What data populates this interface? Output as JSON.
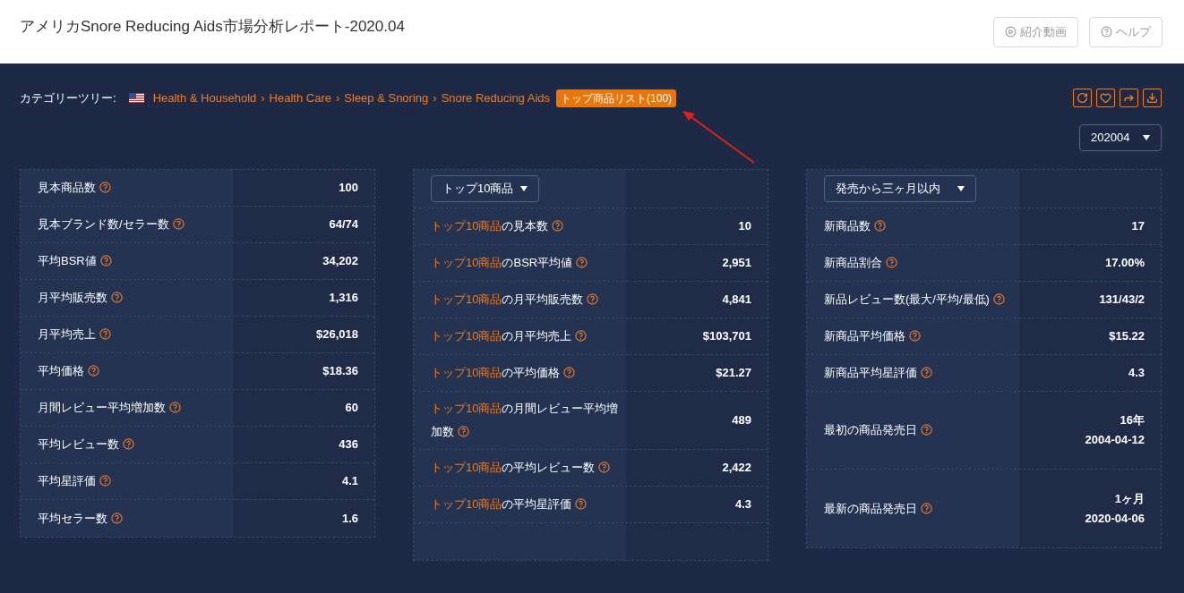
{
  "header": {
    "title": "アメリカSnore Reducing Aids市場分析レポート-2020.04",
    "buttons": [
      {
        "kind": "video",
        "label": "紹介動画"
      },
      {
        "kind": "help",
        "label": "ヘルプ"
      }
    ]
  },
  "category_tree": {
    "label": "カテゴリーツリー:",
    "path": [
      "Health & Household",
      "Health Care",
      "Sleep & Snoring",
      "Snore Reducing Aids"
    ],
    "separator": "›",
    "badge": "トップ商品リスト(100)"
  },
  "actions": [
    {
      "kind": "refresh"
    },
    {
      "kind": "favorite"
    },
    {
      "kind": "share"
    },
    {
      "kind": "download"
    }
  ],
  "period_select": {
    "value": "202004"
  },
  "panels": [
    {
      "rows": [
        {
          "label": "見本商品数",
          "value": [
            "100"
          ]
        },
        {
          "label": "見本ブランド数/セラー数",
          "value": [
            "64/74"
          ]
        },
        {
          "label": "平均BSR値",
          "value": [
            "34,202"
          ]
        },
        {
          "label": "月平均販売数",
          "value": [
            "1,316"
          ]
        },
        {
          "label": "月平均売上",
          "value": [
            "$26,018"
          ]
        },
        {
          "label": "平均価格",
          "value": [
            "$18.36"
          ]
        },
        {
          "label": "月間レビュー平均増加数",
          "value": [
            "60"
          ]
        },
        {
          "label": "平均レビュー数",
          "value": [
            "436"
          ]
        },
        {
          "label": "平均星評価",
          "value": [
            "4.1"
          ]
        },
        {
          "label": "平均セラー数",
          "value": [
            "1.6"
          ]
        }
      ]
    },
    {
      "select": "トップ10商品",
      "rows": [
        {
          "highlight": "トップ10商品",
          "label": "の見本数",
          "value": [
            "10"
          ]
        },
        {
          "highlight": "トップ10商品",
          "label": "のBSR平均値",
          "value": [
            "2,951"
          ]
        },
        {
          "highlight": "トップ10商品",
          "label": "の月平均販売数",
          "value": [
            "4,841"
          ]
        },
        {
          "highlight": "トップ10商品",
          "label": "の月平均売上",
          "value": [
            "$103,701"
          ]
        },
        {
          "highlight": "トップ10商品",
          "label": "の平均価格",
          "value": [
            "$21.27"
          ]
        },
        {
          "highlight": "トップ10商品",
          "label": "の月間レビュー平均増加数",
          "value": [
            "489"
          ]
        },
        {
          "highlight": "トップ10商品",
          "label": "の平均レビュー数",
          "value": [
            "2,422"
          ]
        },
        {
          "highlight": "トップ10商品",
          "label": "の平均星評価",
          "value": [
            "4.3"
          ]
        },
        {
          "value": []
        }
      ]
    },
    {
      "select": "発売から三ヶ月以内",
      "rows": [
        {
          "label": "新商品数",
          "value": [
            "17"
          ]
        },
        {
          "label": "新商品割合",
          "value": [
            "17.00%"
          ]
        },
        {
          "label": "新品レビュー数(最大/平均/最低)",
          "value": [
            "131/43/2"
          ]
        },
        {
          "label": "新商品平均価格",
          "value": [
            "$15.22"
          ]
        },
        {
          "label": "新商品平均星評価",
          "value": [
            "4.3"
          ]
        },
        {
          "label": "最初の商品発売日",
          "value": [
            "16年",
            "2004-04-12"
          ]
        },
        {
          "label": "最新の商品発売日",
          "value": [
            "1ヶ月",
            "2020-04-06"
          ]
        }
      ]
    }
  ]
}
